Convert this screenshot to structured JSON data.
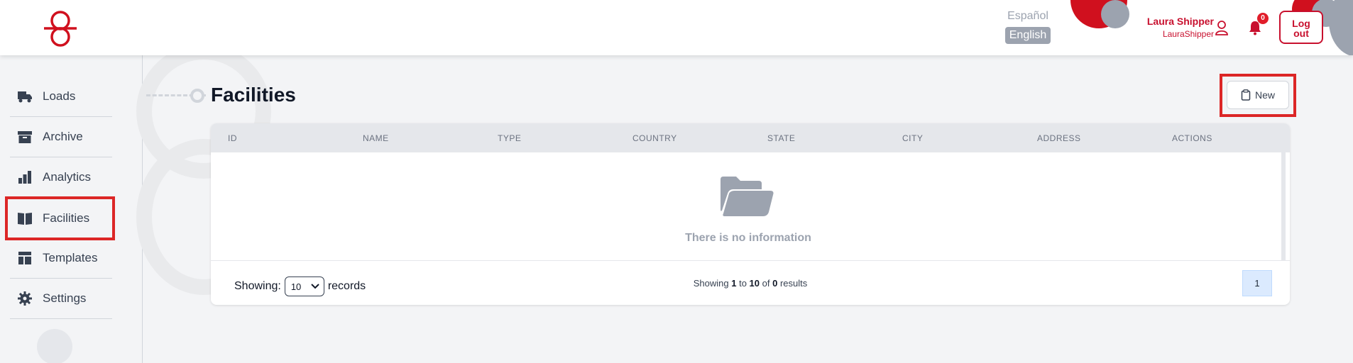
{
  "header": {
    "language_options": [
      "Español",
      "English"
    ],
    "selected_language": "English",
    "user_name": "Laura Shipper",
    "user_handle": "LauraShipper",
    "notification_count": "0",
    "logout_label": "Log out"
  },
  "sidebar": {
    "items": [
      {
        "label": "Loads",
        "icon": "truck-icon"
      },
      {
        "label": "Archive",
        "icon": "archive-icon"
      },
      {
        "label": "Analytics",
        "icon": "bar-chart-icon"
      },
      {
        "label": "Facilities",
        "icon": "book-open-icon"
      },
      {
        "label": "Templates",
        "icon": "layout-icon"
      },
      {
        "label": "Settings",
        "icon": "gear-icon"
      }
    ],
    "active": "Facilities"
  },
  "page": {
    "title": "Facilities",
    "new_button_label": "New"
  },
  "table": {
    "columns": [
      "ID",
      "NAME",
      "TYPE",
      "COUNTRY",
      "STATE",
      "CITY",
      "ADDRESS",
      "ACTIONS"
    ],
    "rows": [],
    "empty_message": "There is no information"
  },
  "footer": {
    "showing_label": "Showing:",
    "page_size": "10",
    "records_label": "records",
    "results_prefix": "Showing",
    "from": "1",
    "to_word": "to",
    "to": "10",
    "of_word": "of",
    "total": "0",
    "results_suffix": "results",
    "current_page": "1"
  },
  "colors": {
    "brand_red": "#c8102e",
    "highlight_red": "#dc2626",
    "gray": "#9ca3af"
  }
}
